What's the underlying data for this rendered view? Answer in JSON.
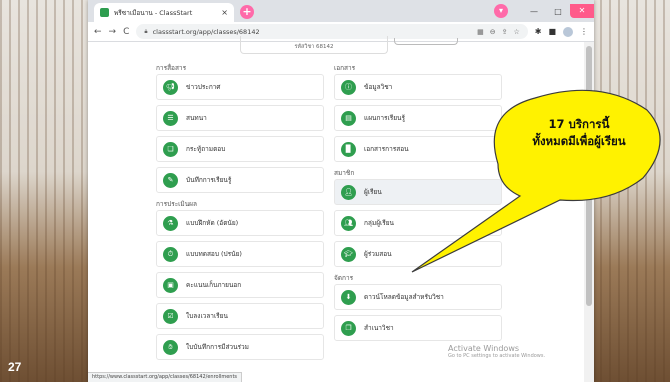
{
  "slide_number": "27",
  "browser": {
    "tab_title": "พรีซาเมือนาน - ClassStart",
    "tab_close": "×",
    "new_tab": "+",
    "url": "classstart.org/app/classes/68142",
    "status_url": "https://www.classstart.org/app/classes/68142/enrollments"
  },
  "page": {
    "class_code": "รหัสวิชา 68142",
    "sections": {
      "communication": {
        "title": "การสื่อสาร",
        "items": [
          "ข่าวประกาศ",
          "สนทนา",
          "กระทู้ถามตอบ",
          "บันทึกการเรียนรู้"
        ]
      },
      "evaluation": {
        "title": "การประเมินผล",
        "items": [
          "แบบฝึกหัด (อัตนัย)",
          "แบบทดสอบ (ปรนัย)",
          "คะแนนเก็บภายนอก",
          "ใบลงเวลาเรียน",
          "ใบบันทึกการมีส่วนร่วม"
        ]
      },
      "documents": {
        "title": "เอกสาร",
        "items": [
          "ข้อมูลวิชา",
          "แผนการเรียนรู้",
          "เอกสารการสอน"
        ]
      },
      "members": {
        "title": "สมาชิก",
        "items": [
          "ผู้เรียน",
          "กลุ่มผู้เรียน",
          "ผู้ร่วมสอน"
        ]
      },
      "management": {
        "title": "จัดการ",
        "items": [
          "ดาวน์โหลดข้อมูลสำหรับวิชา",
          "สำเนาวิชา"
        ]
      }
    }
  },
  "watermark": {
    "line1": "Activate Windows",
    "line2": "Go to PC settings to activate Windows."
  },
  "callout": {
    "line1": "17 บริการนี้",
    "line2": "ทั้งหมดมีเพื่อผู้เรียน",
    "fill": "#fff200"
  },
  "colors": {
    "icon_green": "#2f9e4f",
    "tab_pink": "#ff6aa9"
  }
}
